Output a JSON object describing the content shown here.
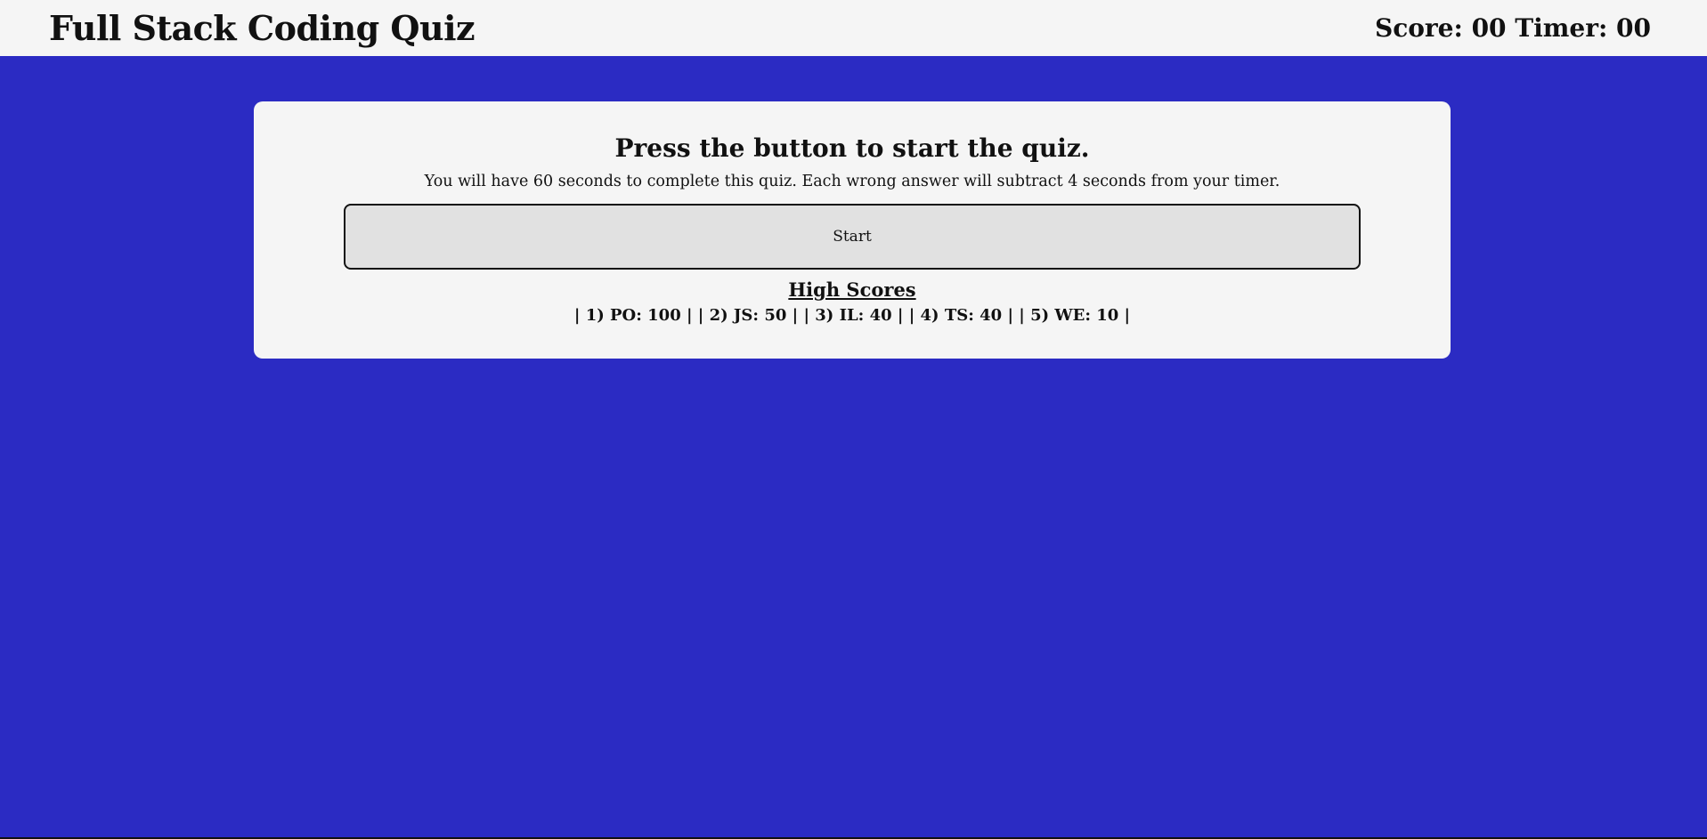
{
  "header": {
    "title": "Full Stack Coding Quiz",
    "score_timer": "Score: 00 Timer: 00"
  },
  "quiz": {
    "prompt": "Press the button to start the quiz.",
    "instructions": "You will have 60 seconds to complete this quiz. Each wrong answer will subtract 4 seconds from your timer.",
    "start_label": "Start"
  },
  "high_scores": {
    "heading": "High Scores",
    "list_text": "| 1) PO: 100 | | 2) JS: 50 | | 3) IL: 40 | | 4) TS: 40 | | 5) WE: 10 |"
  },
  "colors": {
    "background": "#2b2bc3",
    "panel": "#f5f5f5",
    "button": "#e1e1e1"
  }
}
